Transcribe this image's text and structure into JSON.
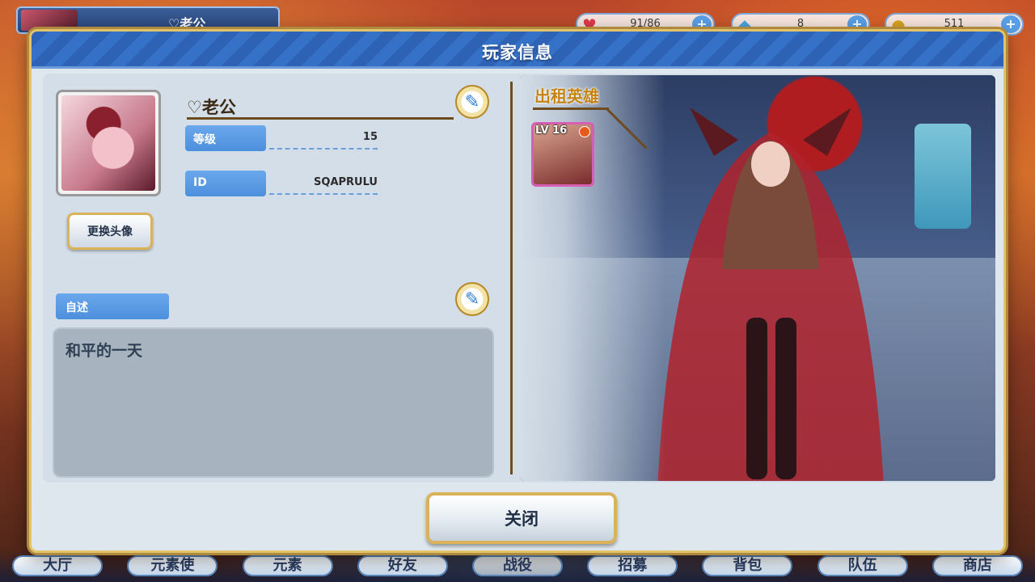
{
  "hud": {
    "player_name": "♡老公",
    "resources": [
      {
        "icon": "heart-icon",
        "value": "91/86"
      },
      {
        "icon": "gem-icon",
        "value": "8"
      },
      {
        "icon": "coin-icon",
        "value": "511"
      }
    ]
  },
  "modal": {
    "title": "玩家信息",
    "player_name": "♡老公",
    "change_avatar_label": "更换头像",
    "fields": [
      {
        "label": "等级",
        "value": "15"
      },
      {
        "label": "ID",
        "value": "SQAPRULU"
      }
    ],
    "bio_label": "自述",
    "bio_text": "和平的一天",
    "rental_hero_title": "出租英雄",
    "rental_hero_level": "LV 16",
    "close_label": "关闭"
  },
  "bottom_nav": [
    "大厅",
    "元素使",
    "元素",
    "好友",
    "战役",
    "招募",
    "背包",
    "队伍",
    "商店"
  ],
  "colors": {
    "header_blue": "#2e62b5",
    "gold_border": "#e2c36a",
    "label_blue": "#4c8fdc",
    "rental_title": "#c58412"
  }
}
